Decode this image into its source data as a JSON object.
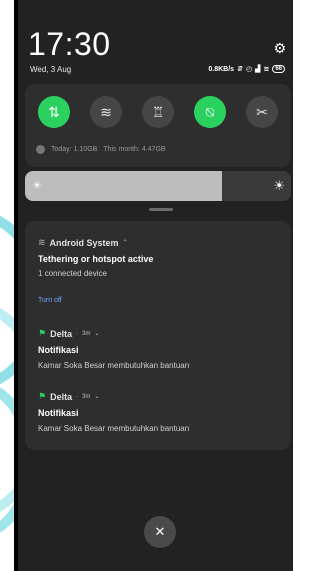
{
  "clock": {
    "time": "17:30",
    "date": "Wed, 3 Aug"
  },
  "status_bar": {
    "speed": "0.8KB/s",
    "battery": "66"
  },
  "quick_settings": {
    "toggles": [
      {
        "name": "mobile-data",
        "icon": "⇅",
        "on": true
      },
      {
        "name": "wifi",
        "icon": "≋",
        "on": false
      },
      {
        "name": "flashlight",
        "icon": "♖",
        "on": false
      },
      {
        "name": "mute",
        "icon": "⍉",
        "on": true
      },
      {
        "name": "screenshot",
        "icon": "✂",
        "on": false
      }
    ],
    "usage_today": "Today: 1.10GB",
    "usage_month": "This month: 4.47GB"
  },
  "brightness": {
    "level": 0.74
  },
  "notifications": [
    {
      "app": "Android System",
      "title": "Tethering or hotspot active",
      "text": "1 connected device",
      "action": "Turn off"
    },
    {
      "app": "Delta",
      "time": "3m",
      "title": "Notifikasi",
      "text": "Kamar Soka Besar membutuhkan bantuan"
    },
    {
      "app": "Delta",
      "time": "3m",
      "title": "Notifikasi",
      "text": "Kamar Soka Besar membutuhkan bantuan"
    }
  ],
  "colors": {
    "accent_green": "#2bd15f",
    "panel": "#222222",
    "card": "#2e2e2e",
    "link": "#6ea1ff"
  }
}
